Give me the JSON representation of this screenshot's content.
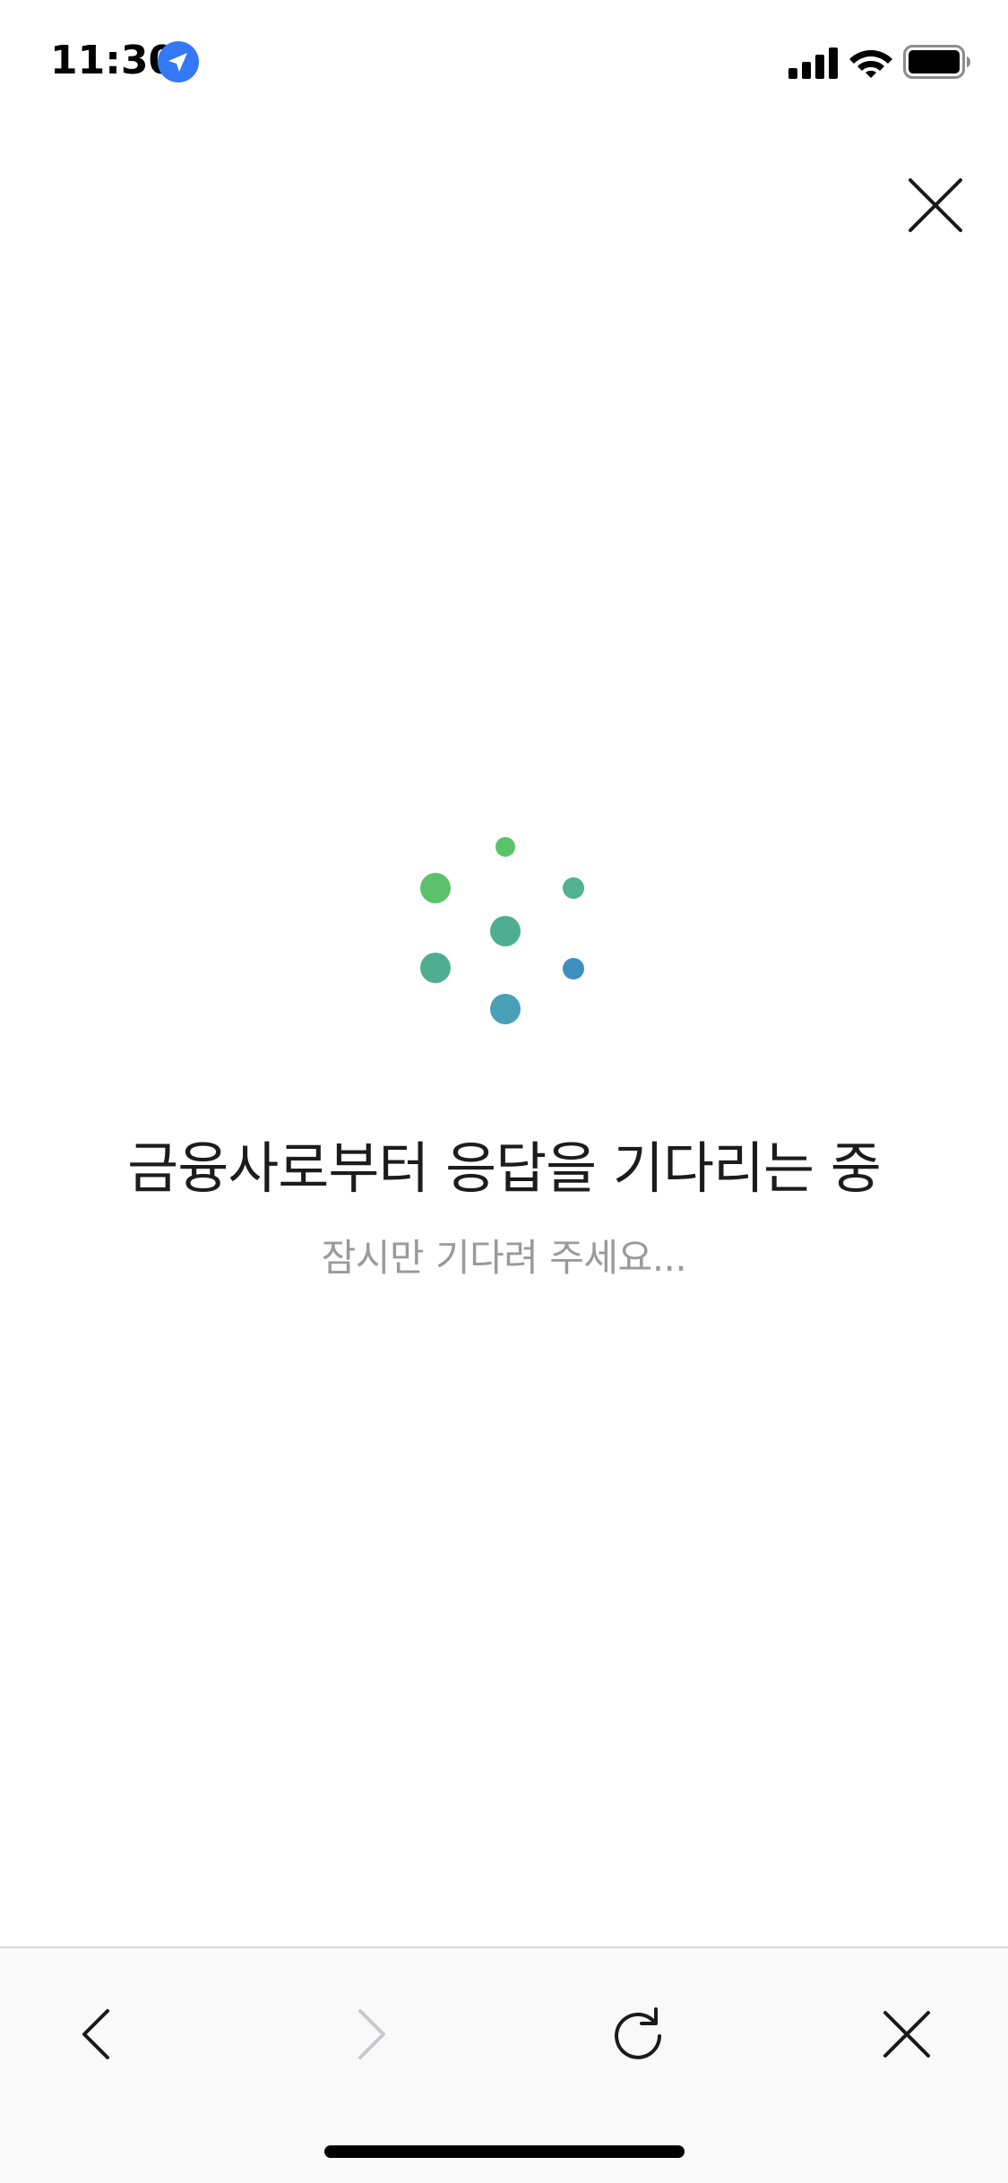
{
  "status_bar": {
    "time": "11:30",
    "icons": [
      "location-arrow-icon",
      "cellular-signal-icon",
      "wifi-icon",
      "battery-icon"
    ],
    "location_color": "#3478f6"
  },
  "header": {
    "close_icon": "close-icon"
  },
  "loader": {
    "colors": [
      "#5cc26a",
      "#4fae85",
      "#4a9fb8",
      "#3f8fbf"
    ]
  },
  "main": {
    "title": "금융사로부터 응답을 기다리는 중",
    "subtitle": "잠시만 기다려 주세요..."
  },
  "toolbar": {
    "buttons": [
      {
        "icon": "chevron-left-icon",
        "enabled": true
      },
      {
        "icon": "chevron-right-icon",
        "enabled": false
      },
      {
        "icon": "reload-icon",
        "enabled": true
      },
      {
        "icon": "close-icon",
        "enabled": true
      }
    ],
    "background": "#f9f9fa"
  }
}
